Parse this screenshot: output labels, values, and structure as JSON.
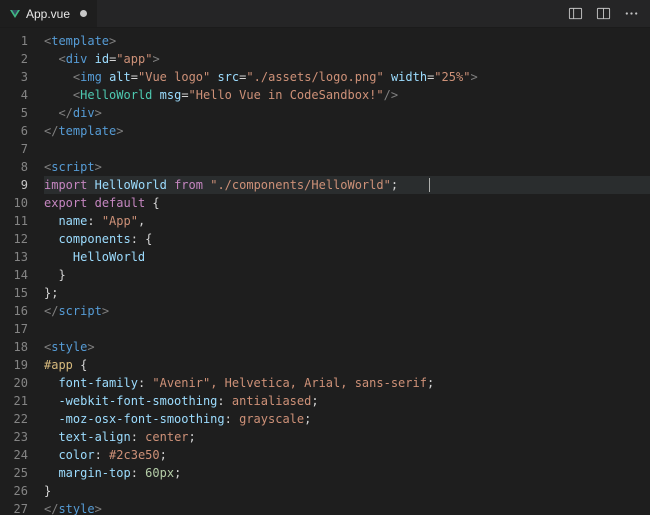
{
  "tab": {
    "filename": "App.vue",
    "dirty": true
  },
  "active_line": 9,
  "code": {
    "l1": {
      "a": "<",
      "b": "template",
      "c": ">"
    },
    "l2": {
      "indent": "  ",
      "a": "<",
      "b": "div",
      "sp": " ",
      "attr": "id",
      "eq": "=",
      "q1": "\"",
      "val": "app",
      "q2": "\"",
      "c": ">"
    },
    "l3": {
      "indent": "    ",
      "a": "<",
      "b": "img",
      "sp": " ",
      "attr1": "alt",
      "eq1": "=",
      "q1a": "\"",
      "val1": "Vue logo",
      "q1b": "\"",
      "sp2": " ",
      "attr2": "src",
      "eq2": "=",
      "q2a": "\"",
      "val2": "./assets/logo.png",
      "q2b": "\"",
      "sp3": " ",
      "attr3": "width",
      "eq3": "=",
      "q3a": "\"",
      "val3": "25%",
      "q3b": "\"",
      "c": ">"
    },
    "l4": {
      "indent": "    ",
      "a": "<",
      "b": "HelloWorld",
      "sp": " ",
      "attr": "msg",
      "eq": "=",
      "q1": "\"",
      "val": "Hello Vue in CodeSandbox!",
      "q2": "\"",
      "c": "/>"
    },
    "l5": {
      "indent": "  ",
      "a": "</",
      "b": "div",
      "c": ">"
    },
    "l6": {
      "a": "</",
      "b": "template",
      "c": ">"
    },
    "l7": {
      "text": ""
    },
    "l8": {
      "a": "<",
      "b": "script",
      "c": ">"
    },
    "l9": {
      "kw1": "import",
      "sp1": " ",
      "name": "HelloWorld",
      "sp2": " ",
      "kw2": "from",
      "sp3": " ",
      "str": "\"./components/HelloWorld\"",
      "semi": ";"
    },
    "l10": {
      "kw1": "export",
      "sp1": " ",
      "kw2": "default",
      "sp2": " ",
      "brace": "{"
    },
    "l11": {
      "indent": "  ",
      "key": "name",
      "colon": ":",
      "sp": " ",
      "str": "\"App\"",
      "comma": ","
    },
    "l12": {
      "indent": "  ",
      "key": "components",
      "colon": ":",
      "sp": " ",
      "brace": "{"
    },
    "l13": {
      "indent": "    ",
      "name": "HelloWorld"
    },
    "l14": {
      "indent": "  ",
      "brace": "}"
    },
    "l15": {
      "brace": "}",
      "semi": ";"
    },
    "l16": {
      "a": "</",
      "b": "script",
      "c": ">"
    },
    "l17": {
      "text": ""
    },
    "l18": {
      "a": "<",
      "b": "style",
      "c": ">"
    },
    "l19": {
      "sel": "#app",
      "sp": " ",
      "brace": "{"
    },
    "l20": {
      "indent": "  ",
      "prop": "font-family",
      "colon": ":",
      "sp": " ",
      "val": "\"Avenir\", Helvetica, Arial, sans-serif",
      "semi": ";"
    },
    "l21": {
      "indent": "  ",
      "prop": "-webkit-font-smoothing",
      "colon": ":",
      "sp": " ",
      "val": "antialiased",
      "semi": ";"
    },
    "l22": {
      "indent": "  ",
      "prop": "-moz-osx-font-smoothing",
      "colon": ":",
      "sp": " ",
      "val": "grayscale",
      "semi": ";"
    },
    "l23": {
      "indent": "  ",
      "prop": "text-align",
      "colon": ":",
      "sp": " ",
      "val": "center",
      "semi": ";"
    },
    "l24": {
      "indent": "  ",
      "prop": "color",
      "colon": ":",
      "sp": " ",
      "val": "#2c3e50",
      "semi": ";"
    },
    "l25": {
      "indent": "  ",
      "prop": "margin-top",
      "colon": ":",
      "sp": " ",
      "val": "60px",
      "semi": ";"
    },
    "l26": {
      "brace": "}"
    },
    "l27": {
      "a": "</",
      "b": "style",
      "c": ">"
    }
  }
}
